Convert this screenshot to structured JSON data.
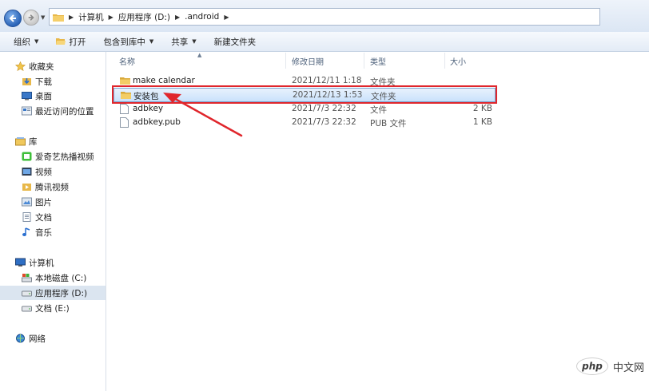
{
  "breadcrumb": [
    "计算机",
    "应用程序 (D:)",
    ".android"
  ],
  "toolbar": {
    "organize": "组织",
    "open": "打开",
    "include_library": "包含到库中",
    "share": "共享",
    "new_folder": "新建文件夹"
  },
  "sidebar": {
    "favorites": "收藏夹",
    "downloads": "下载",
    "desktop": "桌面",
    "recent": "最近访问的位置",
    "libraries": "库",
    "iqiyi": "爱奇艺热播视频",
    "videos": "视频",
    "tencent": "腾讯视频",
    "pictures": "图片",
    "documents": "文档",
    "music": "音乐",
    "computer": "计算机",
    "drive_c": "本地磁盘 (C:)",
    "drive_d": "应用程序 (D:)",
    "drive_e": "文档 (E:)",
    "network": "网络"
  },
  "columns": {
    "name": "名称",
    "date": "修改日期",
    "type": "类型",
    "size": "大小"
  },
  "files": [
    {
      "name": "make calendar",
      "date": "2021/12/11 1:18",
      "type": "文件夹",
      "size": "",
      "kind": "folder"
    },
    {
      "name": "安装包",
      "date": "2021/12/13 1:53",
      "type": "文件夹",
      "size": "",
      "kind": "folder"
    },
    {
      "name": "adbkey",
      "date": "2021/7/3 22:32",
      "type": "文件",
      "size": "2 KB",
      "kind": "file"
    },
    {
      "name": "adbkey.pub",
      "date": "2021/7/3 22:32",
      "type": "PUB 文件",
      "size": "1 KB",
      "kind": "file"
    }
  ],
  "watermark": {
    "logo": "php",
    "text": "中文网"
  },
  "colors": {
    "highlight": "#e0262c",
    "selection": "#c9e1fb"
  }
}
